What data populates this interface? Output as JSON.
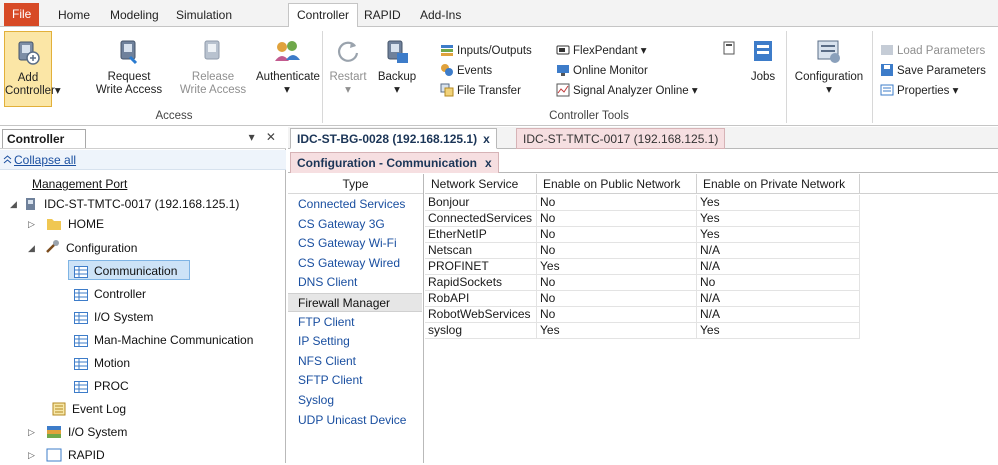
{
  "ribbon_tabs": [
    {
      "label": "File",
      "state": "file"
    },
    {
      "label": "Home",
      "state": ""
    },
    {
      "label": "Modeling",
      "state": ""
    },
    {
      "label": "Simulation",
      "state": ""
    },
    {
      "label": "Controller",
      "state": "active"
    },
    {
      "label": "RAPID",
      "state": ""
    },
    {
      "label": "Add-Ins",
      "state": ""
    }
  ],
  "ribbon": {
    "add_controller": {
      "line1": "Add",
      "line2": "Controller",
      "arrow": "▾"
    },
    "request_write": {
      "line1": "Request",
      "line2": "Write Access"
    },
    "release_write": {
      "line1": "Release",
      "line2": "Write Access"
    },
    "authenticate": "Authenticate",
    "restart": "Restart",
    "backup": "Backup",
    "inputs_outputs": "Inputs/Outputs",
    "events": "Events",
    "file_transfer": "File Transfer",
    "flexpendant": "FlexPendant",
    "online_monitor": "Online Monitor",
    "signal_analyzer": "Signal Analyzer Online",
    "jobs": "Jobs",
    "configuration": "Configuration",
    "load_parameters": "Load Parameters",
    "save_parameters": "Save Parameters",
    "properties": "Properties",
    "group_access": "Access",
    "group_controller_tools": "Controller Tools",
    "dropdown": "▾"
  },
  "left_panel": {
    "title": "Controller",
    "controls": "▾ ✕",
    "collapse_all": "Collapse all",
    "tree": [
      {
        "label": "Management Port"
      },
      {
        "label": "IDC-ST-TMTC-0017 (192.168.125.1)"
      },
      {
        "label": "HOME"
      },
      {
        "label": "Configuration"
      },
      {
        "label": "Communication"
      },
      {
        "label": "Controller"
      },
      {
        "label": "I/O System"
      },
      {
        "label": "Man-Machine Communication"
      },
      {
        "label": "Motion"
      },
      {
        "label": "PROC"
      },
      {
        "label": "Event Log"
      },
      {
        "label": "I/O System"
      },
      {
        "label": "RAPID"
      }
    ]
  },
  "doc_tabs": [
    {
      "label": "IDC-ST-BG-0028 (192.168.125.1)",
      "close": "x"
    },
    {
      "label": "IDC-ST-TMTC-0017 (192.168.125.1)"
    }
  ],
  "sub_tab": {
    "label": "Configuration - Communication",
    "close": "x"
  },
  "type_list": {
    "header": "Type",
    "items": [
      "Connected Services",
      "CS Gateway 3G",
      "CS Gateway Wi-Fi",
      "CS Gateway Wired",
      "DNS Client",
      "Firewall Manager",
      "FTP Client",
      "IP Setting",
      "NFS Client",
      "SFTP Client",
      "Syslog",
      "UDP Unicast Device"
    ],
    "selected": "Firewall Manager"
  },
  "grid": {
    "columns": [
      "Network Service",
      "Enable on Public Network",
      "Enable on Private Network"
    ],
    "rows": [
      [
        "Bonjour",
        "No",
        "Yes"
      ],
      [
        "ConnectedServices",
        "No",
        "Yes"
      ],
      [
        "EtherNetIP",
        "No",
        "Yes"
      ],
      [
        "Netscan",
        "No",
        "N/A"
      ],
      [
        "PROFINET",
        "Yes",
        "N/A"
      ],
      [
        "RapidSockets",
        "No",
        "No"
      ],
      [
        "RobAPI",
        "No",
        "N/A"
      ],
      [
        "RobotWebServices",
        "No",
        "N/A"
      ],
      [
        "syslog",
        "Yes",
        "Yes"
      ]
    ]
  },
  "colors": {
    "accent": "#1a4fa0",
    "file_tab": "#d74a26",
    "selection": "#cde3f7",
    "inactive_tab": "#f6dfe1"
  }
}
